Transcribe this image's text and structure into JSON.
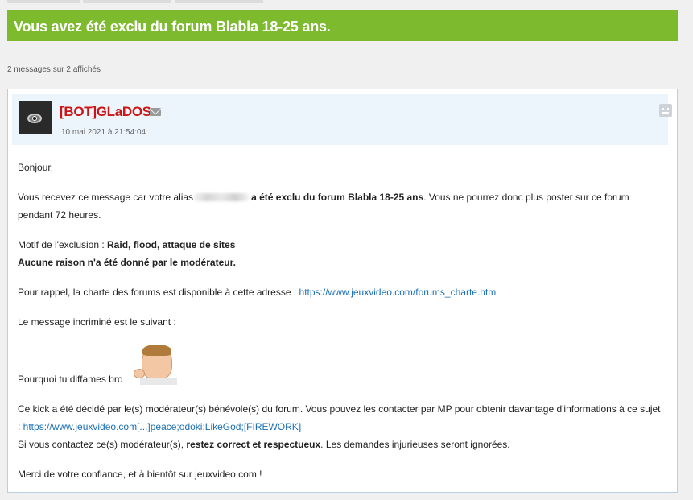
{
  "banner": {
    "title": "Vous avez été exclu du forum Blabla 18-25 ans."
  },
  "message_count": "2 messages sur 2 affichés",
  "message": {
    "author": "[BOT]GLaDOS",
    "date": "10 mai 2021 à 21:54:04",
    "greeting": "Bonjour,",
    "p1_pre": "Vous recevez ce message car votre alias",
    "p1_bold": "a été exclu du forum Blabla 18-25 ans",
    "p1_post": ". Vous ne pourrez donc plus poster sur ce forum pendant 72 heures.",
    "motif_label": "Motif de l'exclusion : ",
    "motif_value": "Raid, flood, attaque de sites",
    "no_reason": "Aucune raison n'a été donné par le modérateur.",
    "charte_text": "Pour rappel, la charte des forums est disponible à cette adresse : ",
    "charte_link": "https://www.jeuxvideo.com/forums_charte.htm",
    "incrimine": "Le message incriminé est le suivant :",
    "quoted_text": "Pourquoi tu diffames bro",
    "kick_text": "Ce kick a été décidé par le(s) modérateur(s) bénévole(s) du forum. Vous pouvez les contacter par MP pour obtenir davantage d'informations à ce sujet : ",
    "kick_link": "https://www.jeuxvideo.com[...]peace;odoki;LikeGod;[FIREWORK]",
    "contact_pre": "Si vous contactez ce(s) modérateur(s), ",
    "contact_bold": "restez correct et respectueux",
    "contact_post": ". Les demandes injurieuses seront ignorées.",
    "closing": "Merci de votre confiance, et à bientôt sur jeuxvideo.com !"
  },
  "icons": {
    "mail": "envelope-icon",
    "report": "sad-face-icon"
  },
  "colors": {
    "banner": "#7dba2e",
    "author": "#cc1616",
    "link": "#1a6fb4",
    "header_bg": "#ecf5fc"
  }
}
